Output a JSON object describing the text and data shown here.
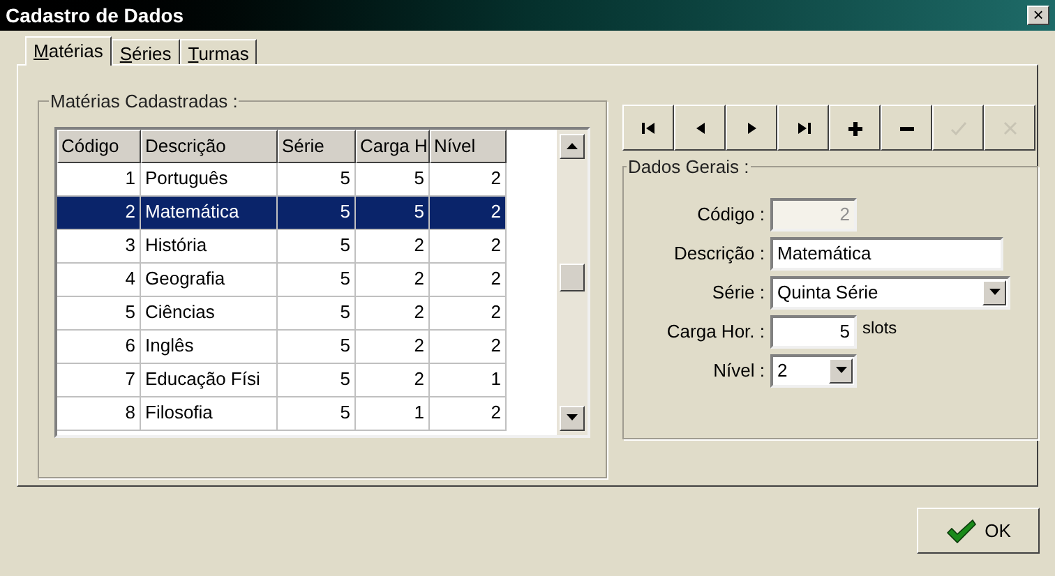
{
  "window": {
    "title": "Cadastro de Dados",
    "close": "×"
  },
  "tabs": [
    {
      "label": "Matérias",
      "selected": true
    },
    {
      "label": "Séries",
      "selected": false
    },
    {
      "label": "Turmas",
      "selected": false
    }
  ],
  "list_group": {
    "title": "Matérias Cadastradas :",
    "table": {
      "columns": [
        "Código",
        "Descrição",
        "Série",
        "Carga H",
        "Nível"
      ],
      "rows": [
        {
          "cells": [
            "1",
            "Português",
            "5",
            "5",
            "2"
          ],
          "selected": false
        },
        {
          "cells": [
            "2",
            "Matemática",
            "5",
            "5",
            "2"
          ],
          "selected": true
        },
        {
          "cells": [
            "3",
            "História",
            "5",
            "2",
            "2"
          ],
          "selected": false
        },
        {
          "cells": [
            "4",
            "Geografia",
            "5",
            "2",
            "2"
          ],
          "selected": false
        },
        {
          "cells": [
            "5",
            "Ciências",
            "5",
            "2",
            "2"
          ],
          "selected": false
        },
        {
          "cells": [
            "6",
            "Inglês",
            "5",
            "2",
            "2"
          ],
          "selected": false
        },
        {
          "cells": [
            "7",
            "Educação Físi",
            "5",
            "2",
            "1"
          ],
          "selected": false
        },
        {
          "cells": [
            "8",
            "Filosofia",
            "5",
            "1",
            "2"
          ],
          "selected": false
        }
      ]
    }
  },
  "toolbar": [
    {
      "kind": "first",
      "disabled": false
    },
    {
      "kind": "prev",
      "disabled": false
    },
    {
      "kind": "next",
      "disabled": false
    },
    {
      "kind": "last",
      "disabled": false
    },
    {
      "kind": "add",
      "disabled": false
    },
    {
      "kind": "remove",
      "disabled": false
    },
    {
      "kind": "confirm",
      "disabled": true
    },
    {
      "kind": "cancel",
      "disabled": true
    }
  ],
  "details": {
    "title": "Dados Gerais :",
    "fields": [
      {
        "kind": "number",
        "label": "Código :",
        "value": "2",
        "disabled": true
      },
      {
        "kind": "text",
        "label": "Descrição :",
        "value": "Matemática",
        "disabled": false
      },
      {
        "kind": "select",
        "label": "Série :",
        "value": "Quinta Série"
      },
      {
        "kind": "unit",
        "label": "Carga Hor. :",
        "value": "5",
        "unit": "slots"
      },
      {
        "kind": "small_select",
        "label": "Nível :",
        "value": "2"
      }
    ]
  },
  "ok_button": {
    "label": "OK"
  }
}
